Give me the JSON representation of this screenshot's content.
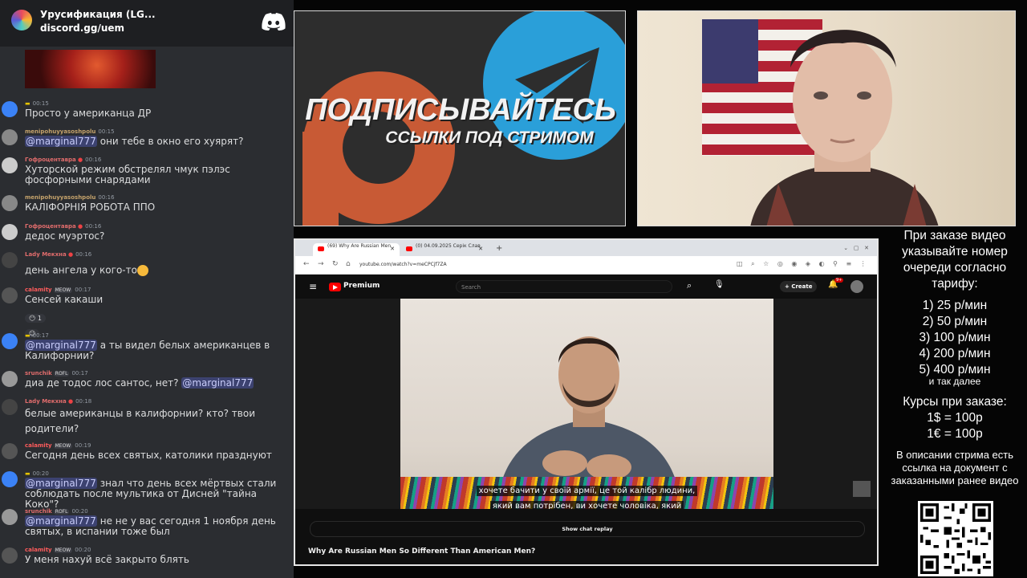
{
  "chat": {
    "server_name": "Урусификация (LG...",
    "server_invite": "discord.gg/uem",
    "messages": [
      {
        "user": "",
        "time": "00:15",
        "text": "Просто у американца ДР",
        "avatar_color": "#3b82f6"
      },
      {
        "user": "menipohuyyasoshpolu",
        "time": "00:15",
        "mention": "@marginal777",
        "text": " они тебе в окно его хуярят?",
        "avatar_color": "#888888"
      },
      {
        "user": "Гофроцентавра",
        "time": "00:16",
        "text": "Хуторской режим обстрелял чмук пэлэс фосфорными снарядами",
        "avatar_color": "#cccccc"
      },
      {
        "user": "menipohuyyasoshpolu",
        "time": "00:16",
        "text": "КАЛІФОРНІЯ РОБОТА ППО",
        "avatar_color": "#888888"
      },
      {
        "user": "Гофроцентавра",
        "time": "00:16",
        "text": "дедос муэртос?",
        "avatar_color": "#cccccc"
      },
      {
        "user": "Lady Мекхна",
        "time": "00:16",
        "text": "день ангела у кого-то",
        "avatar_color": "#444444"
      },
      {
        "user": "calamity",
        "badge": "MEOW",
        "time": "00:17",
        "text": "Сенсей какаши",
        "reaction_count": "1",
        "avatar_color": "#555555"
      },
      {
        "user": "",
        "time": "00:17",
        "mention": "@marginal777",
        "text": " а ты видел белых американцев в Калифорнии?",
        "avatar_color": "#3b82f6"
      },
      {
        "user": "srunchik",
        "badge": "ROFL",
        "time": "00:17",
        "text": "диа де тодос лос сантос, нет? ",
        "mention_end": "@marginal777",
        "avatar_color": "#999999"
      },
      {
        "user": "Lady Мекхна",
        "time": "00:18",
        "text": "белые американцы в калифорнии? кто? твои родители?",
        "avatar_color": "#444444"
      },
      {
        "user": "calamity",
        "badge": "MEOW",
        "time": "00:19",
        "text": "Сегодня день всех святых, католики празднуют",
        "avatar_color": "#555555"
      },
      {
        "user": "",
        "time": "00:20",
        "mention": "@marginal777",
        "text": " знал что день всех мёртвых стали соблюдать после мультика от Дисней \"тайна Коко\"?",
        "avatar_color": "#3b82f6"
      },
      {
        "user": "srunchik",
        "badge": "ROFL",
        "time": "00:20",
        "mention": "@marginal777",
        "text": " не не у вас сегодня 1 ноября день святых, в испании тоже был",
        "avatar_color": "#999999"
      },
      {
        "user": "calamity",
        "badge": "MEOW",
        "time": "00:20",
        "text": "У меня нахуй всё закрыто блять",
        "avatar_color": "#555555"
      }
    ]
  },
  "promo": {
    "title": "ПОДПИСЫВАЙТЕСЬ",
    "subtitle": "ССЫЛКИ ПОД СТРИМОМ"
  },
  "browser": {
    "tabs": [
      {
        "label": "(69) Why Are Russian Men"
      },
      {
        "label": "(0) 04.09.2025 Серік Слав"
      }
    ],
    "url": "youtube.com/watch?v=meCPCjf7ZA",
    "brand": "Premium",
    "search_placeholder": "Search",
    "create_label": "Create",
    "notification_count": "9+",
    "subtitle_line1": "хочете бачити у своїй армії, це той калібр людини,",
    "subtitle_line2": "який вам потрібен, ви хочете чоловіка, який",
    "chat_replay_label": "Show chat replay",
    "video_title": "Why Are Russian Men So Different Than American Men?"
  },
  "info": {
    "order_text": "При заказе видео указывайте номер очереди согласно тарифу:",
    "prices": [
      "1) 25 р/мин",
      "2) 50 р/мин",
      "3) 100 р/мин",
      "4) 200 р/мин",
      "5) 400 р/мин"
    ],
    "more": "и так далее",
    "rates_title": "Курсы при заказе:",
    "rates": [
      "1$ = 100р",
      "1€ = 100р"
    ],
    "description": "В описании стрима есть ссылка на документ с заказанными ранее видео"
  }
}
